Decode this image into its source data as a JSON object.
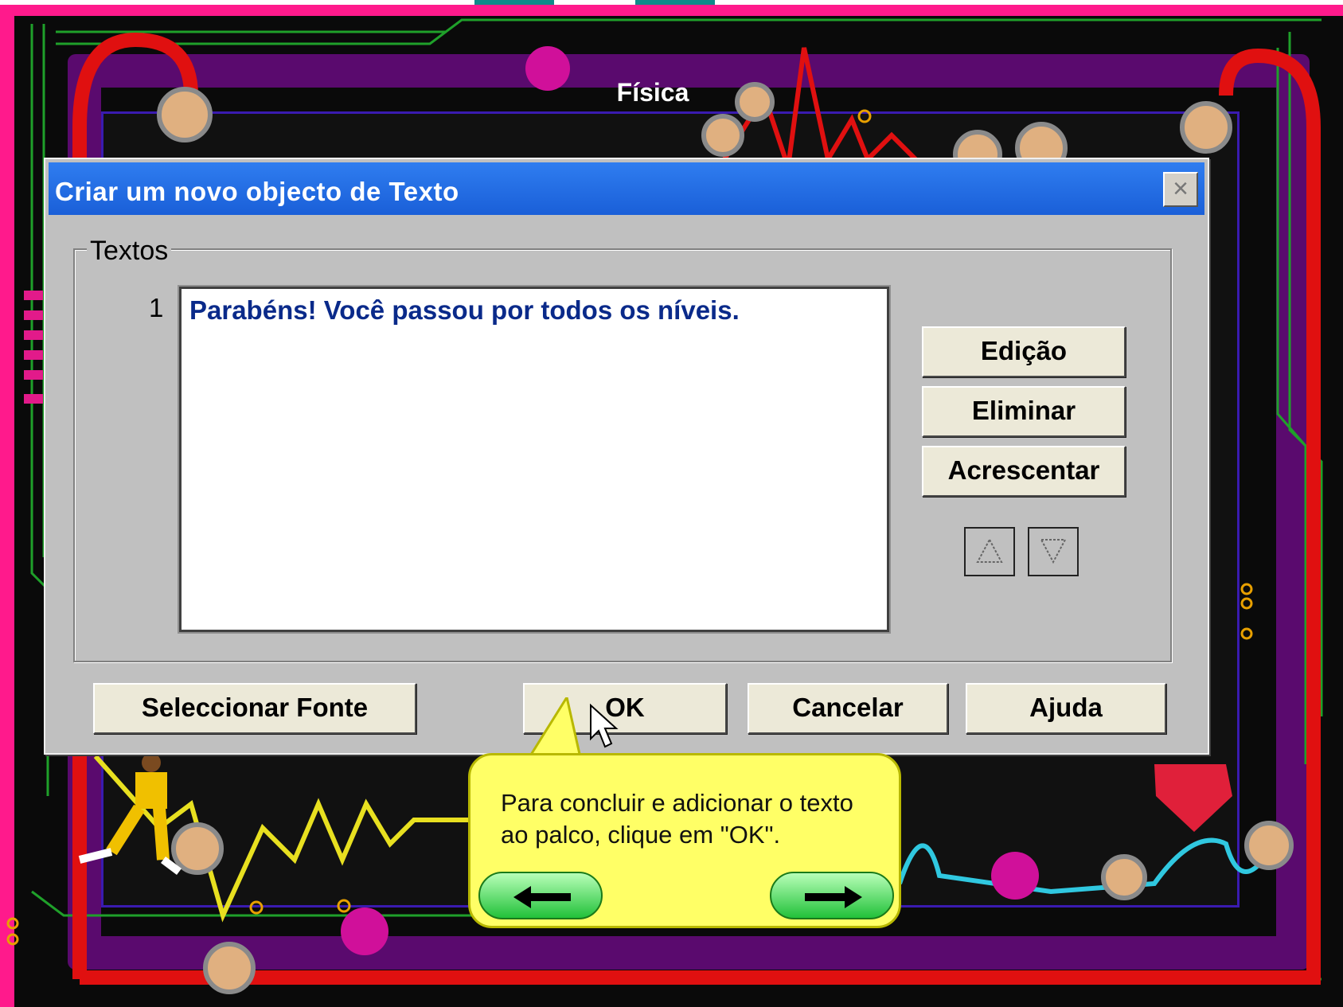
{
  "stage": {
    "title": "Física"
  },
  "dialog": {
    "title": "Criar um novo objecto de Texto",
    "close_symbol": "×",
    "group_label": "Textos",
    "texts": [
      {
        "number": "1",
        "text": "Parabéns! Você passou por todos os níveis."
      }
    ],
    "buttons": {
      "edit": "Edição",
      "delete": "Eliminar",
      "add": "Acrescentar",
      "select_font": "Seleccionar Fonte",
      "ok": "OK",
      "cancel": "Cancelar",
      "help": "Ajuda"
    },
    "icons": {
      "move_up": "up-triangle-icon",
      "move_down": "down-triangle-icon"
    }
  },
  "tooltip": {
    "text": "Para concluir e adicionar o texto ao palco, clique em \"OK\".",
    "prev_icon": "left-arrow-icon",
    "next_icon": "right-arrow-icon"
  },
  "colors": {
    "frame_pink": "#ff1a8c",
    "titlebar_blue": "#1a5fd8",
    "text_blue": "#0a2a8a",
    "bubble_yellow": "#ffff66",
    "nav_green": "#22c13a"
  }
}
